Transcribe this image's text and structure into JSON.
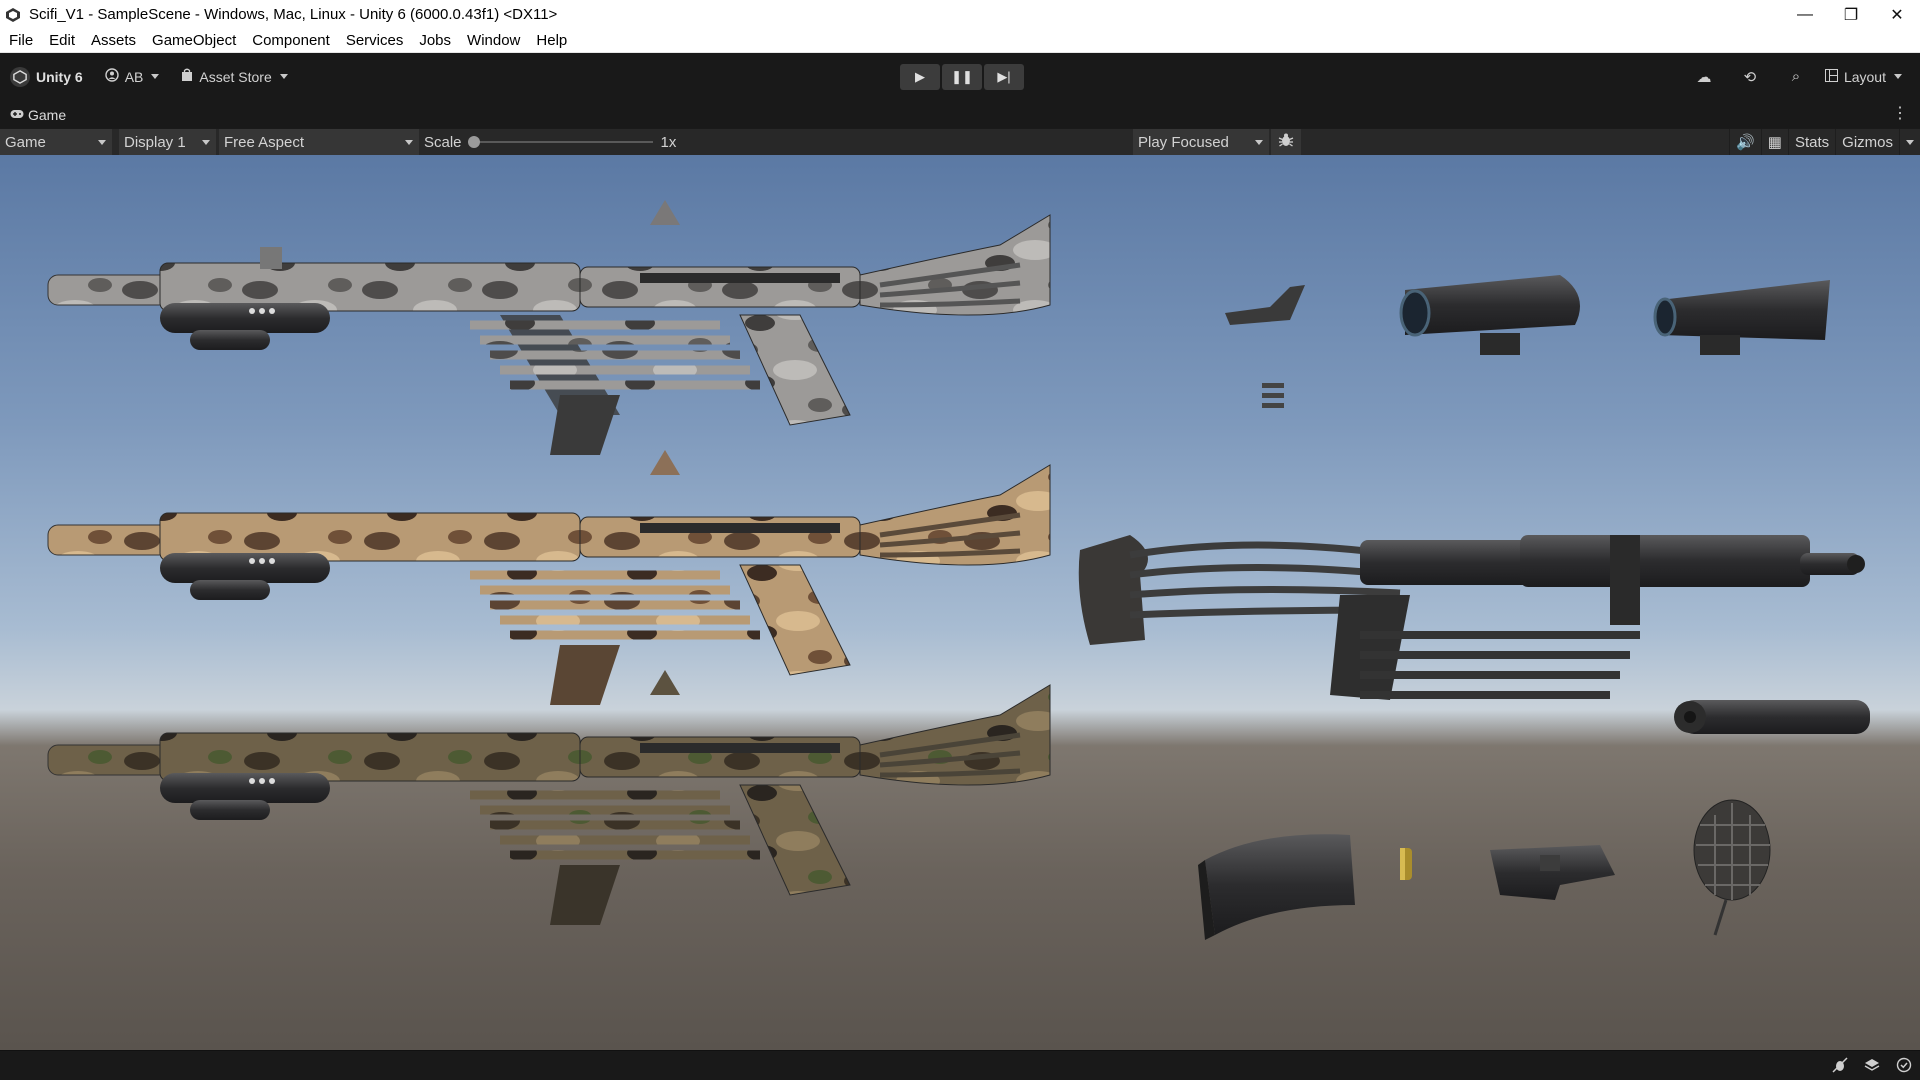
{
  "window": {
    "title": "Scifi_V1 - SampleScene - Windows, Mac, Linux - Unity 6 (6000.0.43f1) <DX11>",
    "controls": {
      "minimize": "—",
      "maximize": "❐",
      "close": "✕"
    }
  },
  "menu": [
    "File",
    "Edit",
    "Assets",
    "GameObject",
    "Component",
    "Services",
    "Jobs",
    "Window",
    "Help"
  ],
  "toolbar": {
    "brand": "Unity 6",
    "account": "AB",
    "asset_store": "Asset Store",
    "play_icon": "▶",
    "pause_icon": "❚❚",
    "step_icon": "▶|",
    "cloud_icon": "☁",
    "history_icon": "⟲",
    "search_icon": "⌕",
    "layout": "Layout"
  },
  "tab": {
    "label": "Game",
    "menu_icon": "⋮"
  },
  "game_view": {
    "display_mode": "Game",
    "display": "Display 1",
    "aspect": "Free Aspect",
    "scale_label": "Scale",
    "scale_value": "1x",
    "scale_level": 0.0,
    "play_mode": "Play Focused",
    "audio_icon": "🔊",
    "grid_icon": "▦",
    "stats": "Stats",
    "gizmos": "Gizmos"
  },
  "colors": {
    "editor_bg": "#191919",
    "toolbar_bg": "#282828",
    "sky_top": "#5b79a4",
    "ground": "#6a635c"
  },
  "scene": {
    "objects": [
      "rifle-grey-camo",
      "rifle-desert-camo",
      "rifle-woodland-camo",
      "rifle-black",
      "sight-small",
      "scope-round",
      "scope-angular",
      "rail-stack",
      "suppressor",
      "magazine",
      "bullet",
      "flashlight",
      "grenade"
    ]
  }
}
